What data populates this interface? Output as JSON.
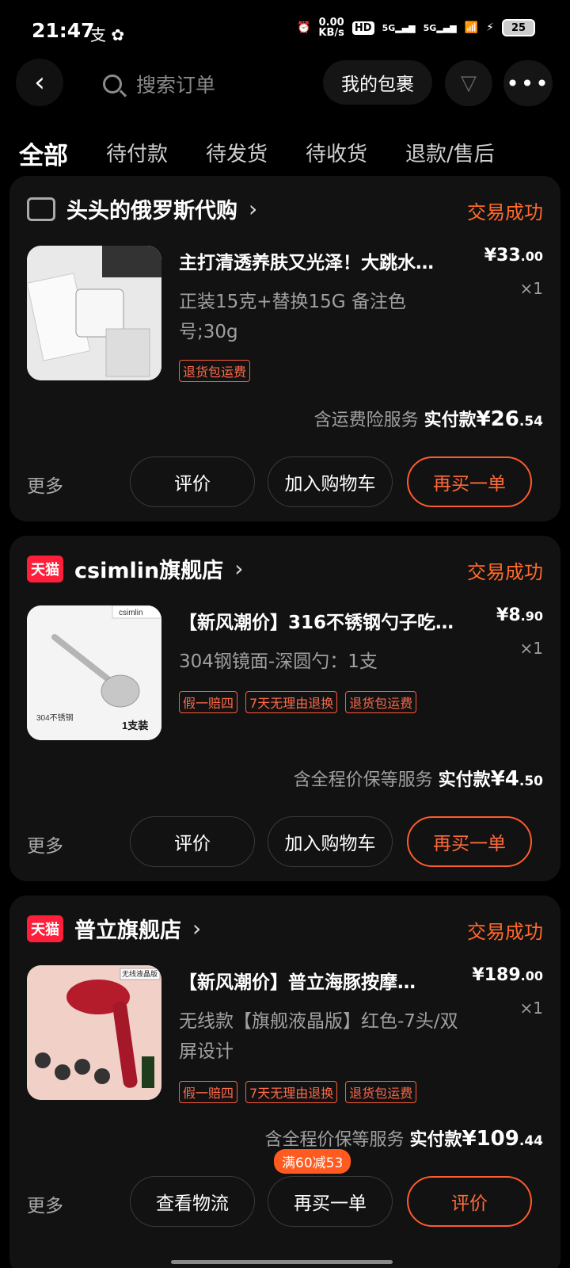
{
  "status_bar": {
    "time": "21:47",
    "app_icons": "支 ✿",
    "net_speed_top": "0.00",
    "net_speed_bottom": "KB/s",
    "hd": "HD",
    "sim1": "5G",
    "sim2": "5G",
    "battery": "25"
  },
  "header": {
    "search_placeholder": "搜索订单",
    "my_packages": "我的包裹"
  },
  "tabs": [
    "全部",
    "待付款",
    "待发货",
    "待收货",
    "退款/售后"
  ],
  "orders": [
    {
      "shop": "头头的俄罗斯代购",
      "status": "交易成功",
      "title": "主打清透养肤又光泽！大跳水…",
      "spec": "正装15克+替换15G 备注色号;30g",
      "price_int": "¥33",
      "price_dec": ".00",
      "qty": "×1",
      "tags": [
        "退货包运费"
      ],
      "service": "含运费险服务",
      "paid_label": "实付款",
      "paid_int": "¥26",
      "paid_dec": ".54",
      "more": "更多",
      "buttons": [
        "评价",
        "加入购物车",
        "再买一单"
      ]
    },
    {
      "shop": "csimlin旗舰店",
      "status": "交易成功",
      "title": "【新风潮价】316不锈钢勺子吃…",
      "spec": "304钢镜面-深圆勺：1支",
      "price_int": "¥8",
      "price_dec": ".90",
      "qty": "×1",
      "tags": [
        "假一赔四",
        "7天无理由退换",
        "退货包运费"
      ],
      "service": "含全程价保等服务",
      "paid_label": "实付款",
      "paid_int": "¥4",
      "paid_dec": ".50",
      "more": "更多",
      "buttons": [
        "评价",
        "加入购物车",
        "再买一单"
      ]
    },
    {
      "shop": "普立旗舰店",
      "status": "交易成功",
      "title": "【新风潮价】普立海豚按摩…",
      "spec": "无线款【旗舰液晶版】红色-7头/双屏设计",
      "price_int": "¥189",
      "price_dec": ".00",
      "qty": "×1",
      "tags": [
        "假一赔四",
        "7天无理由退换",
        "退货包运费"
      ],
      "service": "含全程价保等服务",
      "paid_label": "实付款",
      "paid_int": "¥109",
      "paid_dec": ".44",
      "more": "更多",
      "buttons": [
        "查看物流",
        "再买一单",
        "评价"
      ],
      "promo_badge": "满60减53"
    }
  ],
  "thumb_texts": {
    "spoon_brand": "csimlin",
    "spoon_material": "304不锈钢",
    "spoon_count": "1支装",
    "massager_label": "无线液晶版"
  },
  "colors": {
    "accent": "#ff6a2c",
    "tmall": "#ff1f3a",
    "card_bg": "#121212"
  },
  "tmall_logo": "天猫"
}
